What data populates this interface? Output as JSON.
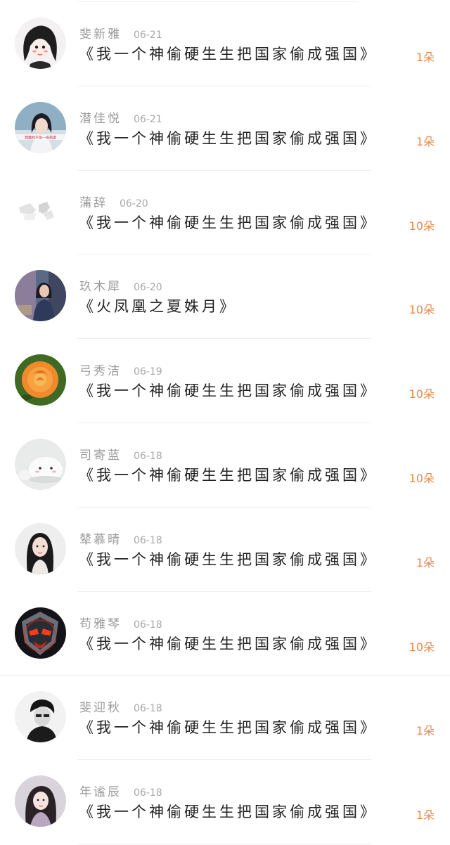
{
  "items": [
    {
      "name": "斐新雅",
      "date": "06-21",
      "title": "《我一个神偷硬生生把国家偷成强国》",
      "gift": "1朵",
      "avatar": "cartoon-girl-avatar"
    },
    {
      "name": "潜佳悦",
      "date": "06-21",
      "title": "《我一个神偷硬生生把国家偷成强国》",
      "gift": "1朵",
      "avatar": "girl-photo-avatar",
      "avatar_caption": "我要的不是一份热度"
    },
    {
      "name": "蒲辞",
      "date": "06-20",
      "title": "《我一个神偷硬生生把国家偷成强国》",
      "gift": "10朵",
      "avatar": "faded-sketch-avatar"
    },
    {
      "name": "玖木犀",
      "date": "06-20",
      "title": "《火凤凰之夏姝月》",
      "gift": "10朵",
      "avatar": "woman-photo-avatar"
    },
    {
      "name": "弓秀洁",
      "date": "06-19",
      "title": "《我一个神偷硬生生把国家偷成强国》",
      "gift": "10朵",
      "avatar": "orange-rose-avatar"
    },
    {
      "name": "司寄蓝",
      "date": "06-18",
      "title": "《我一个神偷硬生生把国家偷成强国》",
      "gift": "10朵",
      "avatar": "white-mochi-avatar"
    },
    {
      "name": "辇慕晴",
      "date": "06-18",
      "title": "《我一个神偷硬生生把国家偷成强国》",
      "gift": "1朵",
      "avatar": "girl-portrait-avatar"
    },
    {
      "name": "苟雅琴",
      "date": "06-18",
      "title": "《我一个神偷硬生生把国家偷成强国》",
      "gift": "10朵",
      "avatar": "red-mask-avatar"
    },
    {
      "name": "斐迎秋",
      "date": "06-18",
      "title": "《我一个神偷硬生生把国家偷成强国》",
      "gift": "1朵",
      "avatar": "bw-boy-avatar"
    },
    {
      "name": "年谧辰",
      "date": "06-18",
      "title": "《我一个神偷硬生生把国家偷成强国》",
      "gift": "1朵",
      "avatar": "girl-selfie-avatar"
    }
  ],
  "colors": {
    "gift": "#e8894a",
    "title": "#222222",
    "meta": "#9a9a9a",
    "divider": "#efefef"
  }
}
